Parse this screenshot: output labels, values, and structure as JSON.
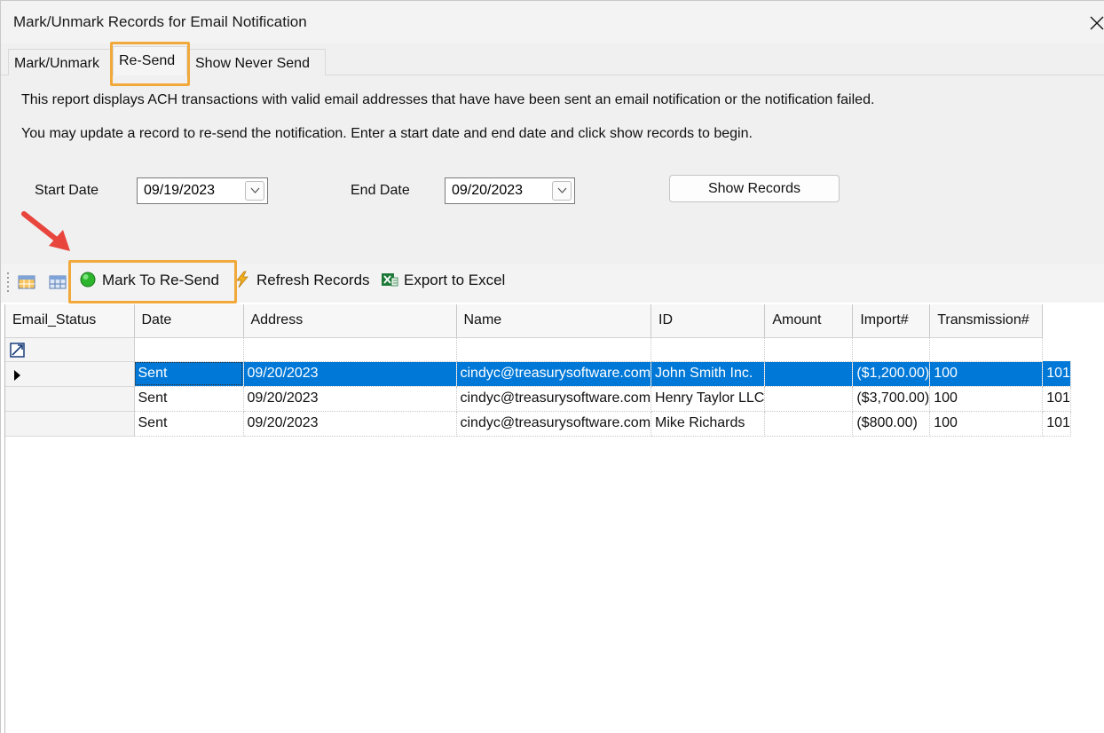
{
  "window": {
    "title": "Mark/Unmark Records for Email Notification",
    "close_label": "✕"
  },
  "tabs": [
    {
      "label": "Mark/Unmark",
      "active": false
    },
    {
      "label": "Re-Send",
      "active": true
    },
    {
      "label": "Show Never Send",
      "active": false
    }
  ],
  "panel": {
    "description_1": "This report displays ACH transactions with valid email addresses that have have been sent an email notification or the notification failed.",
    "description_2": "You may update a record to re-send the notification.  Enter a start date and end date and click show records to begin.",
    "start_date_label": "Start Date",
    "start_date_value": "09/19/2023",
    "end_date_label": "End Date",
    "end_date_value": "09/20/2023",
    "show_records_label": "Show Records"
  },
  "toolbar": {
    "mark_label": "Mark To Re-Send",
    "refresh_label": "Refresh Records",
    "export_label": "Export to Excel"
  },
  "grid": {
    "columns": [
      "Email_Status",
      "Date",
      "Address",
      "Name",
      "ID",
      "Amount",
      "Import#",
      "Transmission#"
    ],
    "rows": [
      [
        "Sent",
        "09/20/2023",
        "cindyc@treasurysoftware.com",
        "John Smith Inc.",
        "",
        "($1,200.00)",
        "100",
        "101"
      ],
      [
        "Sent",
        "09/20/2023",
        "cindyc@treasurysoftware.com",
        "Henry Taylor LLC",
        "",
        "($3,700.00)",
        "100",
        "101"
      ],
      [
        "Sent",
        "09/20/2023",
        "cindyc@treasurysoftware.com",
        "Mike Richards",
        "",
        "($800.00)",
        "100",
        "101"
      ]
    ],
    "selected_row": 0
  },
  "colors": {
    "highlight": "#f2a93b",
    "selection": "#0078d7",
    "arrow": "#e8453c",
    "status_dot": "#2db52d"
  },
  "icons": [
    "close-icon",
    "dropdown-icon",
    "table-icon",
    "grid-icon",
    "green-dot-icon",
    "lightning-icon",
    "excel-icon",
    "row-pointer-icon",
    "new-row-icon",
    "red-arrow-annotation"
  ]
}
